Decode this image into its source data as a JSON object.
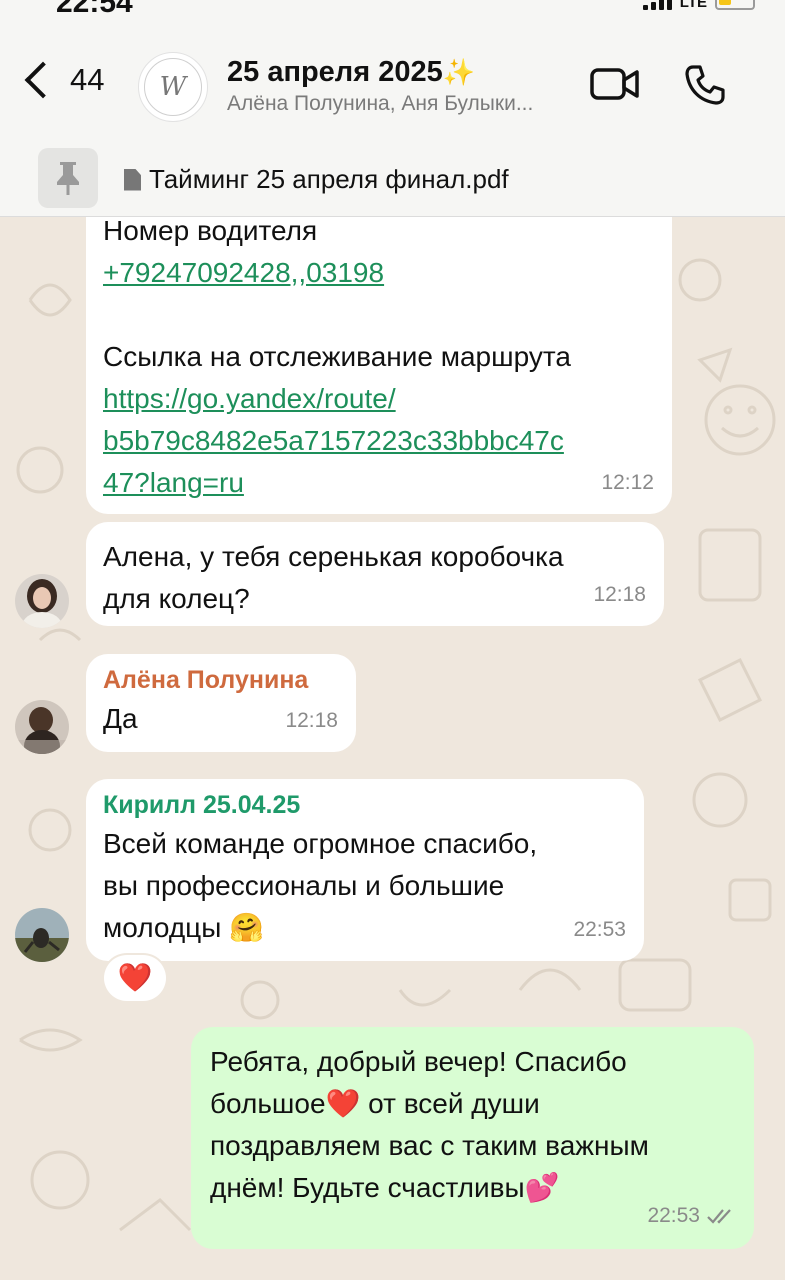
{
  "status_bar": {
    "time": "22:54",
    "network": "LTE"
  },
  "header": {
    "back_count": "44",
    "title": "25 апреля 2025",
    "subtitle": "Алёна Полунина, Аня Булыки..."
  },
  "pinned": {
    "file_name": "Тайминг 25 апреля финал.pdf"
  },
  "messages": [
    {
      "line_driver": "Номер водителя",
      "phone": "+79247092428,,03198",
      "route_label": "Ссылка на отслеживание маршрута",
      "link_line1": "https://go.yandex/route/",
      "link_line2": "b5b79c8482e5a7157223c33bbbc47c",
      "link_line3": "47?lang=ru",
      "time": "12:12"
    },
    {
      "line1": "Алена, у тебя серенькая коробочка",
      "line2": "для колец?",
      "time": "12:18"
    },
    {
      "sender": "Алёна Полунина",
      "text": "Да",
      "time": "12:18"
    },
    {
      "sender": "Кирилл 25.04.25",
      "line1": "Всей команде огромное спасибо,",
      "line2": "вы профессионалы и большие",
      "line3": "молодцы",
      "emoji": "🤗",
      "time": "22:53",
      "reaction": "❤️"
    },
    {
      "line1": "Ребята, добрый вечер! Спасибо",
      "line2a": "большое",
      "heart": "❤️",
      "line2b": " от всей души",
      "line3": "поздравляем вас с таким важным",
      "line4": "днём! Будьте счастливы",
      "emoji": "💕",
      "time": "22:53"
    }
  ],
  "colors": {
    "background": "#efe7dd",
    "outgoing_bubble": "#d9fdd3",
    "link": "#1d8f5a",
    "sender_orange": "#cf6a3e",
    "sender_green": "#1f9a6a"
  }
}
